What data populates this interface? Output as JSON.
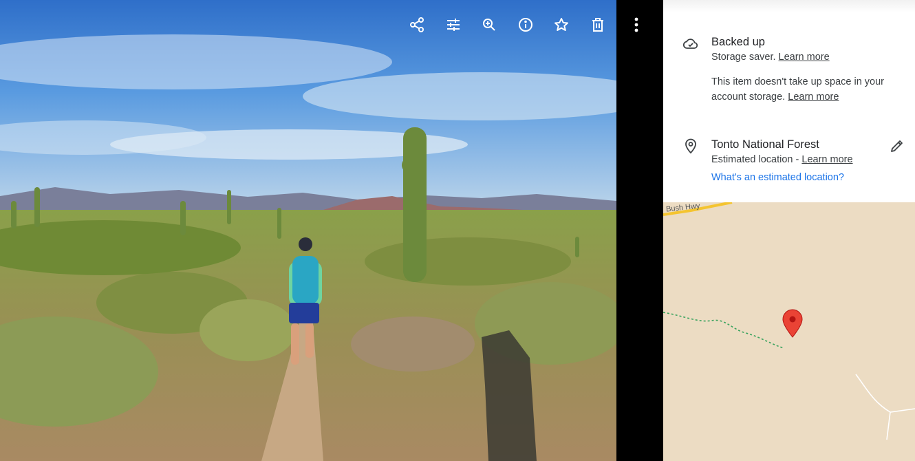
{
  "toolbar": {
    "buttons": [
      {
        "name": "share-icon"
      },
      {
        "name": "edit-adjust-icon"
      },
      {
        "name": "zoom-in-icon"
      },
      {
        "name": "info-icon"
      },
      {
        "name": "favorite-star-icon"
      },
      {
        "name": "delete-icon"
      }
    ],
    "more": "more-vert-icon"
  },
  "info": {
    "backup": {
      "icon": "cloud-done-icon",
      "title": "Backed up",
      "subtitle_prefix": "Storage saver. ",
      "subtitle_link": "Learn more",
      "note": "This item doesn't take up space in your account storage. ",
      "note_link": "Learn more"
    },
    "location": {
      "icon": "location-pin-icon",
      "title": "Tonto National Forest",
      "subtitle_prefix": "Estimated location - ",
      "subtitle_link": "Learn more",
      "help_link": "What's an estimated location?",
      "edit_icon": "pencil-icon"
    }
  },
  "map": {
    "road_label": "Bush Hwy",
    "marker": "map-marker-icon"
  },
  "colors": {
    "link_blue": "#1a73e8",
    "map_bg": "#ecdcc3",
    "marker_red": "#ea4335"
  }
}
